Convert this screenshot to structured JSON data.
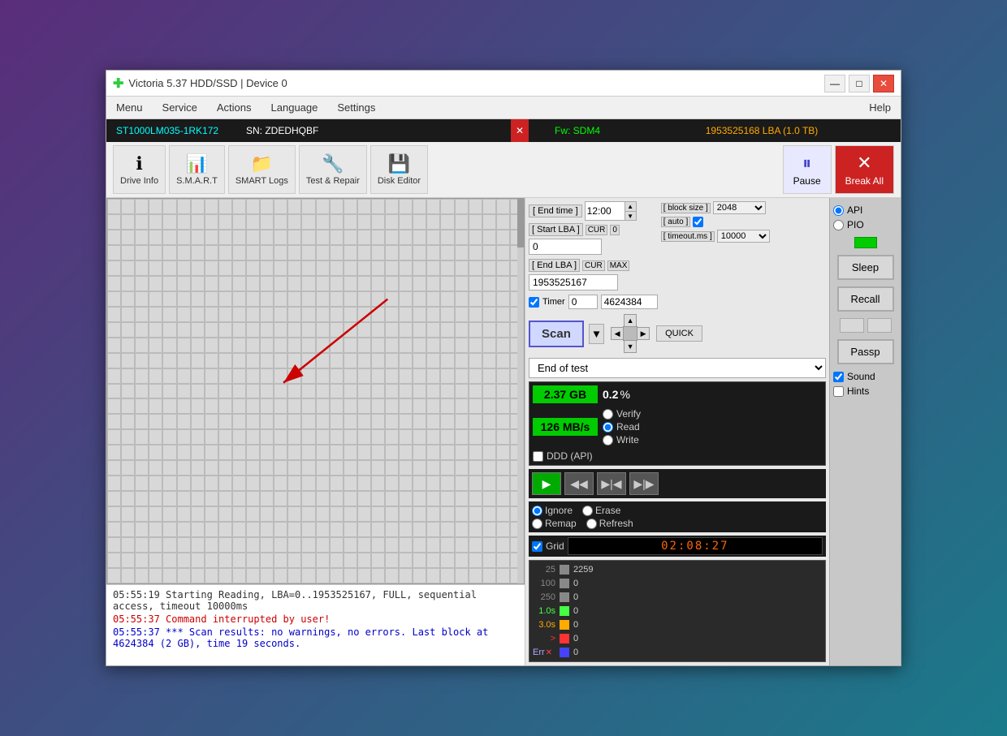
{
  "window": {
    "title": "Victoria 5.37 HDD/SSD | Device 0",
    "icon": "✚"
  },
  "titlebar": {
    "minimize": "—",
    "maximize": "□",
    "close": "✕"
  },
  "menu": {
    "items": [
      "Menu",
      "Service",
      "Actions",
      "Language",
      "Settings",
      "Help"
    ]
  },
  "infobar": {
    "device": "ST1000LM035-1RK172",
    "sn_label": "SN: ZDEDHQBF",
    "close_x": "✕",
    "fw": "Fw: SDM4",
    "lba": "1953525168 LBA (1.0 TB)"
  },
  "toolbar": {
    "drive_info": "Drive Info",
    "smart": "S.M.A.R.T",
    "smart_logs": "SMART Logs",
    "test_repair": "Test & Repair",
    "disk_editor": "Disk Editor",
    "pause": "Pause",
    "break_all": "Break All"
  },
  "scan_controls": {
    "end_time_label": "[ End time ]",
    "end_time_value": "12:00",
    "start_lba_label": "[ Start LBA ]",
    "cur_badge": "CUR",
    "start_lba_value": "0",
    "end_lba_label": "[ End LBA ]",
    "end_lba_cur": "CUR",
    "end_lba_max": "MAX",
    "end_lba_value": "1953525167",
    "timer_label": "Timer",
    "timer_value": "0",
    "timer_value2": "4624384",
    "block_size_label": "[ block size ]",
    "auto_label": "[ auto ]",
    "timeout_label": "[ timeout.ms ]",
    "block_size_value": "2048",
    "timeout_value": "10000",
    "scan_btn": "Scan",
    "quick_btn": "QUICK",
    "end_of_test": "End of test",
    "zero_badge_value": "0"
  },
  "stats": {
    "gb_value": "2.37 GB",
    "pct_value": "0.2",
    "pct_unit": "%",
    "speed_value": "126 MB/s",
    "verify_label": "Verify",
    "read_label": "Read",
    "write_label": "Write",
    "ddd_label": "DDD (API)"
  },
  "playback": {
    "play": "▶",
    "rewind": "◀◀",
    "next": "▶|◀",
    "last": "▶|▶"
  },
  "error_options": {
    "ignore": "Ignore",
    "erase": "Erase",
    "remap": "Remap",
    "refresh": "Refresh"
  },
  "grid_bottom": {
    "grid_label": "Grid",
    "timer_display": "02:08:27"
  },
  "histogram": {
    "rows": [
      {
        "label": "25",
        "color_class": "hist-label-25",
        "bar_class": "bar-25",
        "count": "2259"
      },
      {
        "label": "100",
        "color_class": "hist-label-100",
        "bar_class": "bar-100",
        "count": "0"
      },
      {
        "label": "250",
        "color_class": "hist-label-250",
        "bar_class": "bar-250",
        "count": "0"
      },
      {
        "label": "1.0s",
        "color_class": "hist-label-1s",
        "bar_class": "bar-1s",
        "count": "0"
      },
      {
        "label": "3.0s",
        "color_class": "hist-label-3s",
        "bar_class": "bar-3s",
        "count": "0"
      },
      {
        "label": ">",
        "color_class": "hist-label-gt",
        "bar_class": "bar-gt",
        "count": "0"
      },
      {
        "label": "Err",
        "color_class": "hist-label-err",
        "bar_class": "bar-err",
        "count": "0",
        "has_x": true
      }
    ]
  },
  "sidebar": {
    "api_label": "API",
    "pio_label": "PIO",
    "sleep_btn": "Sleep",
    "recall_btn": "Recall",
    "passp_btn": "Passp",
    "sound_label": "Sound",
    "hints_label": "Hints"
  },
  "log": {
    "entries": [
      {
        "time": "05:55:19",
        "text": " Starting Reading, LBA=0..1953525167, FULL, sequential access, timeout 10000ms",
        "type": "normal"
      },
      {
        "time": "05:55:37",
        "text": " Command interrupted by user!",
        "type": "error"
      },
      {
        "time": "05:55:37",
        "text": " *** Scan results: no warnings, no errors. Last block at 4624384 (2 GB), time 19 seconds.",
        "type": "info"
      }
    ]
  }
}
